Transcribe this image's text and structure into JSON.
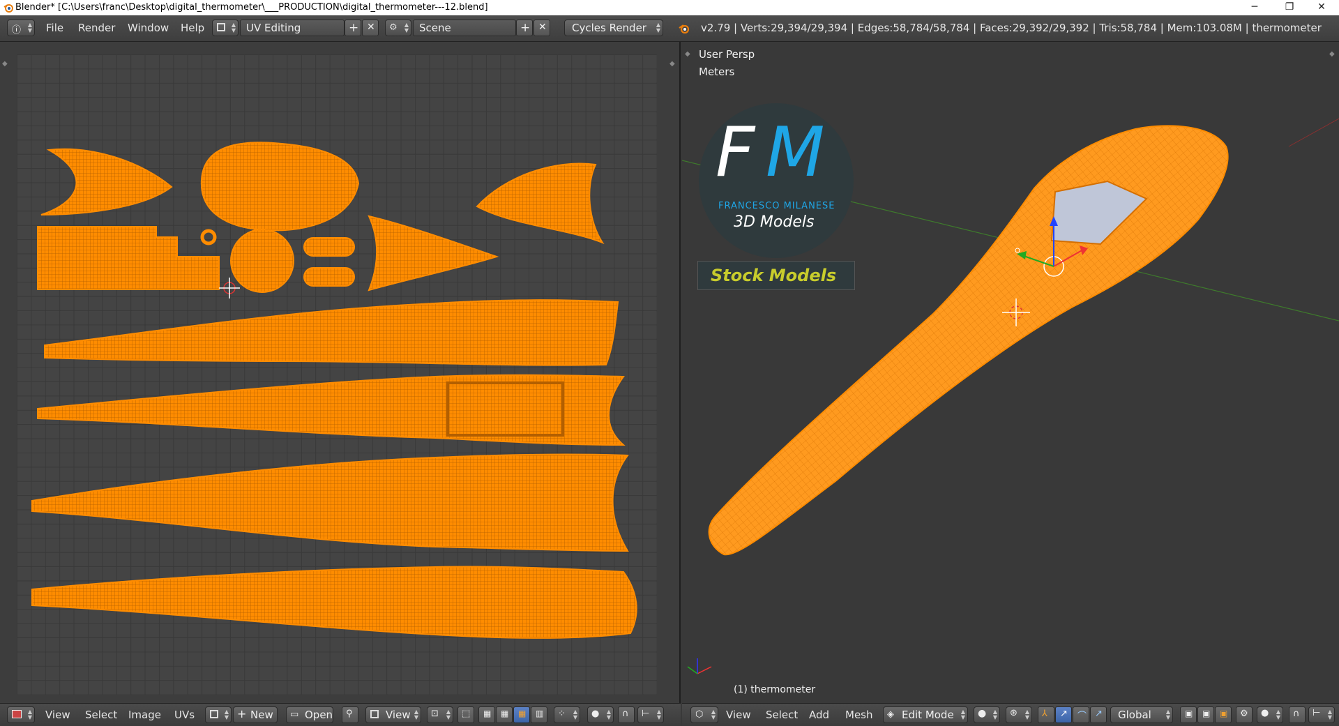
{
  "window": {
    "title": "Blender* [C:\\Users\\franc\\Desktop\\digital_thermometer\\___PRODUCTION\\digital_thermometer---12.blend]",
    "minimize": "─",
    "maximize": "❐",
    "close": "✕"
  },
  "info_header": {
    "menus": [
      "File",
      "Render",
      "Window",
      "Help"
    ],
    "screen_layout": "UV Editing",
    "scene": "Scene",
    "render_engine": "Cycles Render",
    "stats": "v2.79 | Verts:29,394/29,394 | Edges:58,784/58,784 | Faces:29,392/29,392 | Tris:58,784 | Mem:103.08M | thermometer"
  },
  "viewport": {
    "view_name": "User Persp",
    "units": "Meters",
    "object_label": "(1) thermometer",
    "logo": {
      "initials_f": "F",
      "initials_m": "M",
      "author": "FRANCESCO MILANESE",
      "subtitle": "3D Models",
      "banner": "Stock Models"
    }
  },
  "uv_footer": {
    "menus": [
      "View",
      "Select",
      "Image",
      "UVs"
    ],
    "new_label": "New",
    "open_label": "Open",
    "view_label": "View"
  },
  "viewport_footer": {
    "menus": [
      "View",
      "Select",
      "Add",
      "Mesh"
    ],
    "mode": "Edit Mode",
    "orientation": "Global"
  },
  "colors": {
    "uv_mesh": "#ff8c00",
    "background": "#393939",
    "logo_blue": "#1fa6e6",
    "banner_yellow": "#c8cc2c"
  }
}
